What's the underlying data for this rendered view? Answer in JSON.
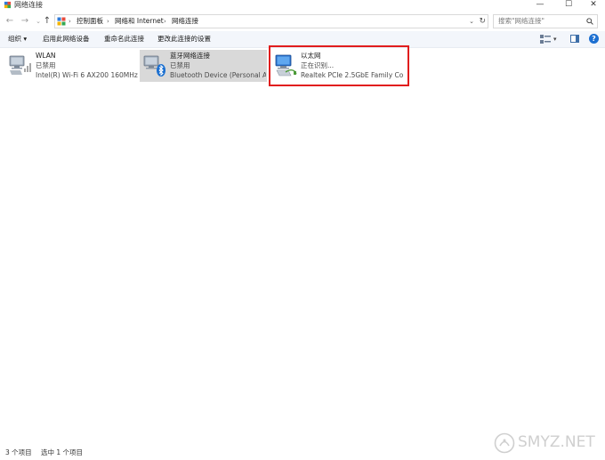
{
  "window": {
    "title": "网络连接",
    "min": "—",
    "max": "☐",
    "close": "✕"
  },
  "nav": {
    "back": "←",
    "forward": "→",
    "recent": "⌄",
    "up": "↑",
    "breadcrumbs": [
      "控制面板",
      "网络和 Internet",
      "网络连接"
    ],
    "separator": "›",
    "dropdown": "⌄",
    "refresh": "↻"
  },
  "search": {
    "placeholder": "搜索\"网络连接\""
  },
  "toolbar": {
    "organize": "组织 ▾",
    "enable": "启用此网络设备",
    "rename": "重命名此连接",
    "change": "更改此连接的设置",
    "view_dropdown": "▾",
    "help": "?"
  },
  "connections": [
    {
      "name": "WLAN",
      "status": "已禁用",
      "device": "Intel(R) Wi-Fi 6 AX200 160MHz"
    },
    {
      "name": "蓝牙网络连接",
      "status": "已禁用",
      "device": "Bluetooth Device (Personal Ar..."
    },
    {
      "name": "以太网",
      "status": "正在识别...",
      "device": "Realtek PCIe 2.5GbE Family Co..."
    }
  ],
  "statusbar": {
    "count": "3 个项目",
    "selected": "选中 1 个项目"
  },
  "watermark": {
    "text": "SMYZ.NET"
  },
  "colors": {
    "highlight": "#e11d1d",
    "selected_bg": "#d9d9d9",
    "help_blue": "#1c6fd1",
    "toolbar_bg": "#f3f6fb"
  }
}
